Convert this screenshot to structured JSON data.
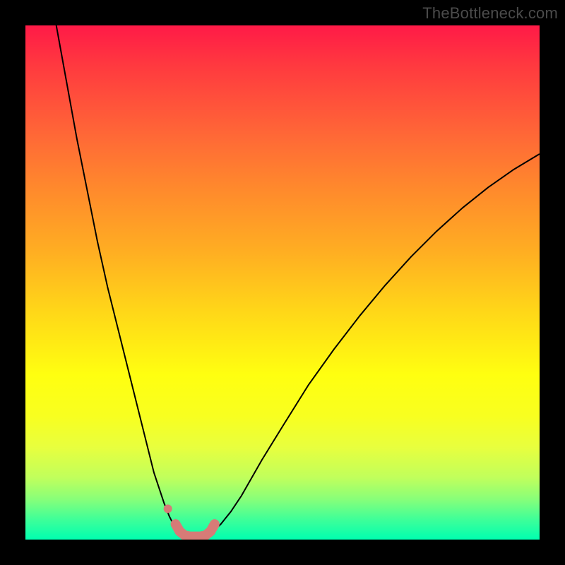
{
  "watermark": "TheBottleneck.com",
  "chart_data": {
    "type": "line",
    "title": "",
    "xlabel": "",
    "ylabel": "",
    "xlim": [
      0,
      100
    ],
    "ylim": [
      0,
      100
    ],
    "grid": false,
    "legend": false,
    "series": [
      {
        "name": "curve-left",
        "stroke": "#000000",
        "stroke_width": 2,
        "x": [
          6,
          8,
          10,
          12,
          14,
          16,
          18,
          20,
          22,
          24,
          25,
          26,
          27,
          28,
          29,
          30
        ],
        "y": [
          100,
          89,
          78,
          68,
          58,
          49,
          41,
          33,
          25,
          17,
          13,
          10,
          7,
          4.5,
          2.5,
          1.2
        ]
      },
      {
        "name": "curve-right",
        "stroke": "#000000",
        "stroke_width": 2,
        "x": [
          36,
          38,
          40,
          42,
          44,
          46,
          50,
          55,
          60,
          65,
          70,
          75,
          80,
          85,
          90,
          95,
          100
        ],
        "y": [
          1.2,
          3,
          5.5,
          8.5,
          12,
          15.5,
          22,
          30,
          37,
          43.5,
          49.5,
          55,
          60,
          64.5,
          68.5,
          72,
          75
        ]
      },
      {
        "name": "marker-band",
        "stroke": "#d77b77",
        "stroke_width": 14,
        "linecap": "round",
        "x": [
          29.2,
          30,
          31,
          32,
          33,
          34,
          35,
          36,
          36.8
        ],
        "y": [
          3.0,
          1.6,
          0.8,
          0.6,
          0.6,
          0.6,
          0.8,
          1.6,
          3.0
        ]
      },
      {
        "name": "marker-dot-left",
        "type": "scatter",
        "fill": "#d77b77",
        "radius": 6,
        "x": [
          27.7
        ],
        "y": [
          6.0
        ]
      }
    ],
    "background_gradient": {
      "orientation": "vertical",
      "stops": [
        {
          "pos": 0.0,
          "color": "#ff1a47"
        },
        {
          "pos": 0.22,
          "color": "#ff6a36"
        },
        {
          "pos": 0.44,
          "color": "#ffae22"
        },
        {
          "pos": 0.68,
          "color": "#ffff10"
        },
        {
          "pos": 0.88,
          "color": "#c0ff5c"
        },
        {
          "pos": 1.0,
          "color": "#00ffb0"
        }
      ]
    }
  }
}
